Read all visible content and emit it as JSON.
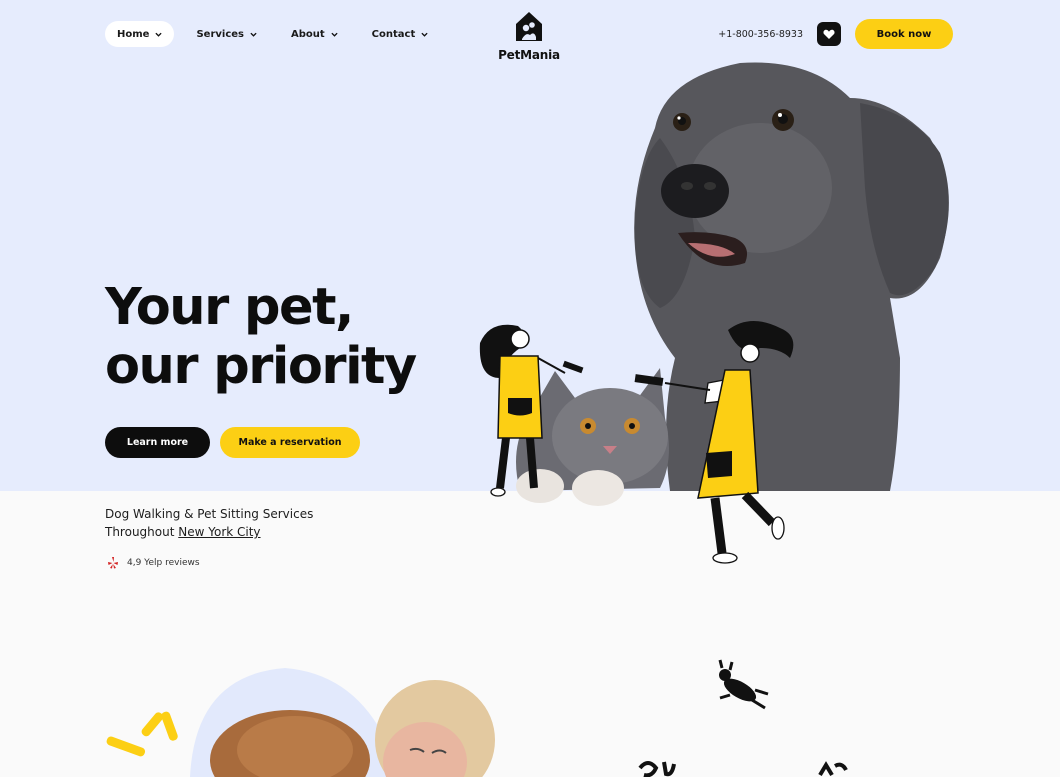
{
  "brand": {
    "name": "PetMania"
  },
  "nav": {
    "items": [
      {
        "label": "Home"
      },
      {
        "label": "Services"
      },
      {
        "label": "About"
      },
      {
        "label": "Contact"
      }
    ],
    "phone": "+1-800-356-8933",
    "book_label": "Book now"
  },
  "hero": {
    "headline_line1": "Your pet,",
    "headline_line2": "our priority",
    "learn_more": "Learn more",
    "reservation": "Make a reservation",
    "sub_line1": "Dog Walking & Pet Sitting Services",
    "sub_line2_prefix": "Throughout ",
    "sub_line2_link": "New York City",
    "reviews": "4,9 Yelp reviews"
  },
  "colors": {
    "accent": "#fccf14",
    "hero_bg": "#e6ecfd",
    "dark": "#0d0d0d"
  },
  "icons": [
    "chevron-down-icon",
    "logo-house-icon",
    "heart-icon",
    "yelp-icon"
  ]
}
